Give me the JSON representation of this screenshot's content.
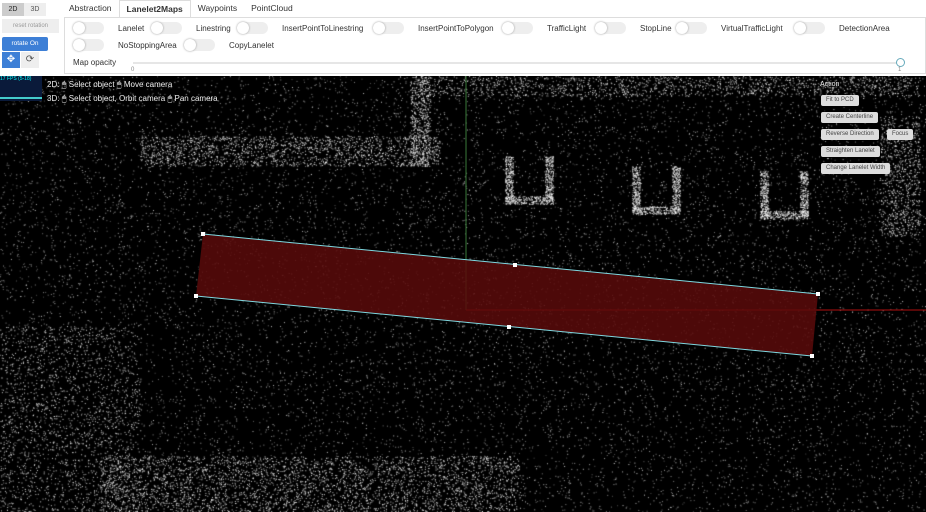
{
  "mode_toggle": {
    "items": [
      "2D",
      "3D"
    ],
    "active": "2D"
  },
  "left": {
    "reset_rotation": "reset rotation",
    "rotate": "rotate On",
    "icons": [
      "move-icon",
      "refresh-icon"
    ]
  },
  "tabs": {
    "items": [
      "Abstraction",
      "Lanelet2Maps",
      "Waypoints",
      "PointCloud"
    ],
    "active": "Lanelet2Maps"
  },
  "toggles": [
    "Lanelet",
    "Linestring",
    "InsertPointToLinestring",
    "InsertPointToPolygon",
    "TrafficLight",
    "StopLine",
    "VirtualTrafficLight",
    "DetectionArea",
    "NoStoppingArea",
    "CopyLanelet"
  ],
  "opacity": {
    "label": "Map opacity",
    "min": "0",
    "max": "1",
    "value": 1
  },
  "fps": "17 FPS (5-18)",
  "hints": {
    "l1_prefix": "2D:",
    "l1_a": "Select object",
    "l1_b": "Move camera",
    "l2_prefix": "3D:",
    "l2_a": "Select object, Orbit camera",
    "l2_b": "Pan camera"
  },
  "action": {
    "title": "Action",
    "fit": "Fit to PCD",
    "centerline": "Create Centerline",
    "reverse": "Reverse Direction",
    "focus": "Focus",
    "straighten": "Straighten Lanelet",
    "width": "Change Lanelet Width"
  },
  "colors": {
    "lanelet_fill": "#5a0a0a",
    "lanelet_edge": "#7fd8e0",
    "accent": "#3d7fd6"
  }
}
